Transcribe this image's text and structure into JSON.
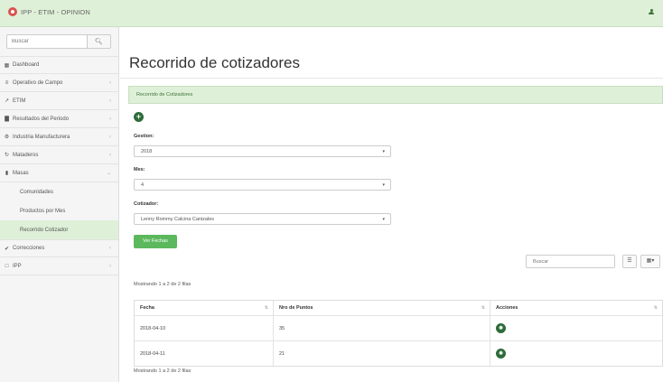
{
  "header": {
    "title": "IPP - ETIM - OPINION"
  },
  "sidebar": {
    "search_placeholder": "Buscar",
    "items": [
      {
        "label": "Dashboard",
        "icon": "dashboard-icon"
      },
      {
        "label": "Operativo de Campo",
        "icon": "operativo-icon"
      },
      {
        "label": "ETIM",
        "icon": "wrench-icon"
      },
      {
        "label": "Resultados del Periodo",
        "icon": "bar-chart-icon"
      },
      {
        "label": "Industria Manufacturera",
        "icon": "industry-icon"
      },
      {
        "label": "Mataderos",
        "icon": "mataderos-icon"
      },
      {
        "label": "Masas",
        "icon": "masas-icon"
      }
    ],
    "subitems": [
      {
        "label": "Comunidades"
      },
      {
        "label": "Productos por Mes"
      },
      {
        "label": "Recorrido Cotizador"
      }
    ],
    "items_after": [
      {
        "label": "Correcciones",
        "icon": "check-icon"
      },
      {
        "label": "IPP",
        "icon": "ipp-icon"
      }
    ]
  },
  "main": {
    "title": "Recorrido de cotizadores",
    "panel_title": "Recorrido de Cotizadores",
    "form": {
      "gestion_label": "Gestion:",
      "gestion_value": "2018",
      "mes_label": "Mes:",
      "mes_value": "4",
      "cotizador_label": "Cotizador:",
      "cotizador_value": "Lenny Rommy Calcina Canizales",
      "submit_label": "Ver Fechas"
    },
    "table": {
      "search_placeholder": "Buscar",
      "info_top": "Mostrando 1 a 2 de 2 filas",
      "info_bottom": "Mostrando 1 a 2 de 2 filas",
      "columns": [
        "Fecha",
        "Nro de Puntos",
        "Acciones"
      ],
      "rows": [
        {
          "fecha": "2018-04-10",
          "puntos": "35"
        },
        {
          "fecha": "2018-04-11",
          "puntos": "21"
        }
      ]
    }
  },
  "colors": {
    "header_bg": "#dff0d8",
    "accent_green": "#5cb85c",
    "dark_green": "#2e6b3a",
    "panel_text": "#3c763d"
  }
}
